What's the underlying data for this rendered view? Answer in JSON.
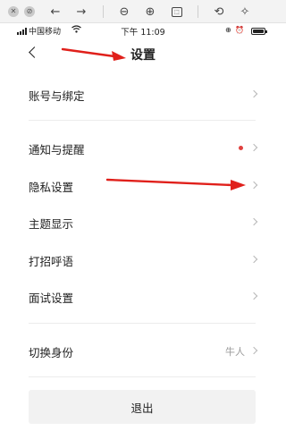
{
  "viewer_toolbar": {
    "icons": [
      "close-icon",
      "block-icon",
      "back-arrow-icon",
      "forward-arrow-icon",
      "zoom-out-icon",
      "zoom-in-icon",
      "fit-page-icon",
      "rotate-icon",
      "magic-wand-icon"
    ]
  },
  "status_bar": {
    "carrier": "中国移动",
    "time": "下午 11:09"
  },
  "header": {
    "title": "设置"
  },
  "settings": {
    "items": [
      {
        "label": "账号与绑定"
      },
      {
        "label": "通知与提醒",
        "has_red_dot": true
      },
      {
        "label": "隐私设置"
      },
      {
        "label": "主题显示"
      },
      {
        "label": "打招呼语"
      },
      {
        "label": "面试设置"
      },
      {
        "label": "切换身份",
        "value": "牛人"
      }
    ],
    "logout_label": "退出"
  },
  "colors": {
    "annotation_arrow": "#e0201b",
    "notification_dot": "#e0413f"
  }
}
